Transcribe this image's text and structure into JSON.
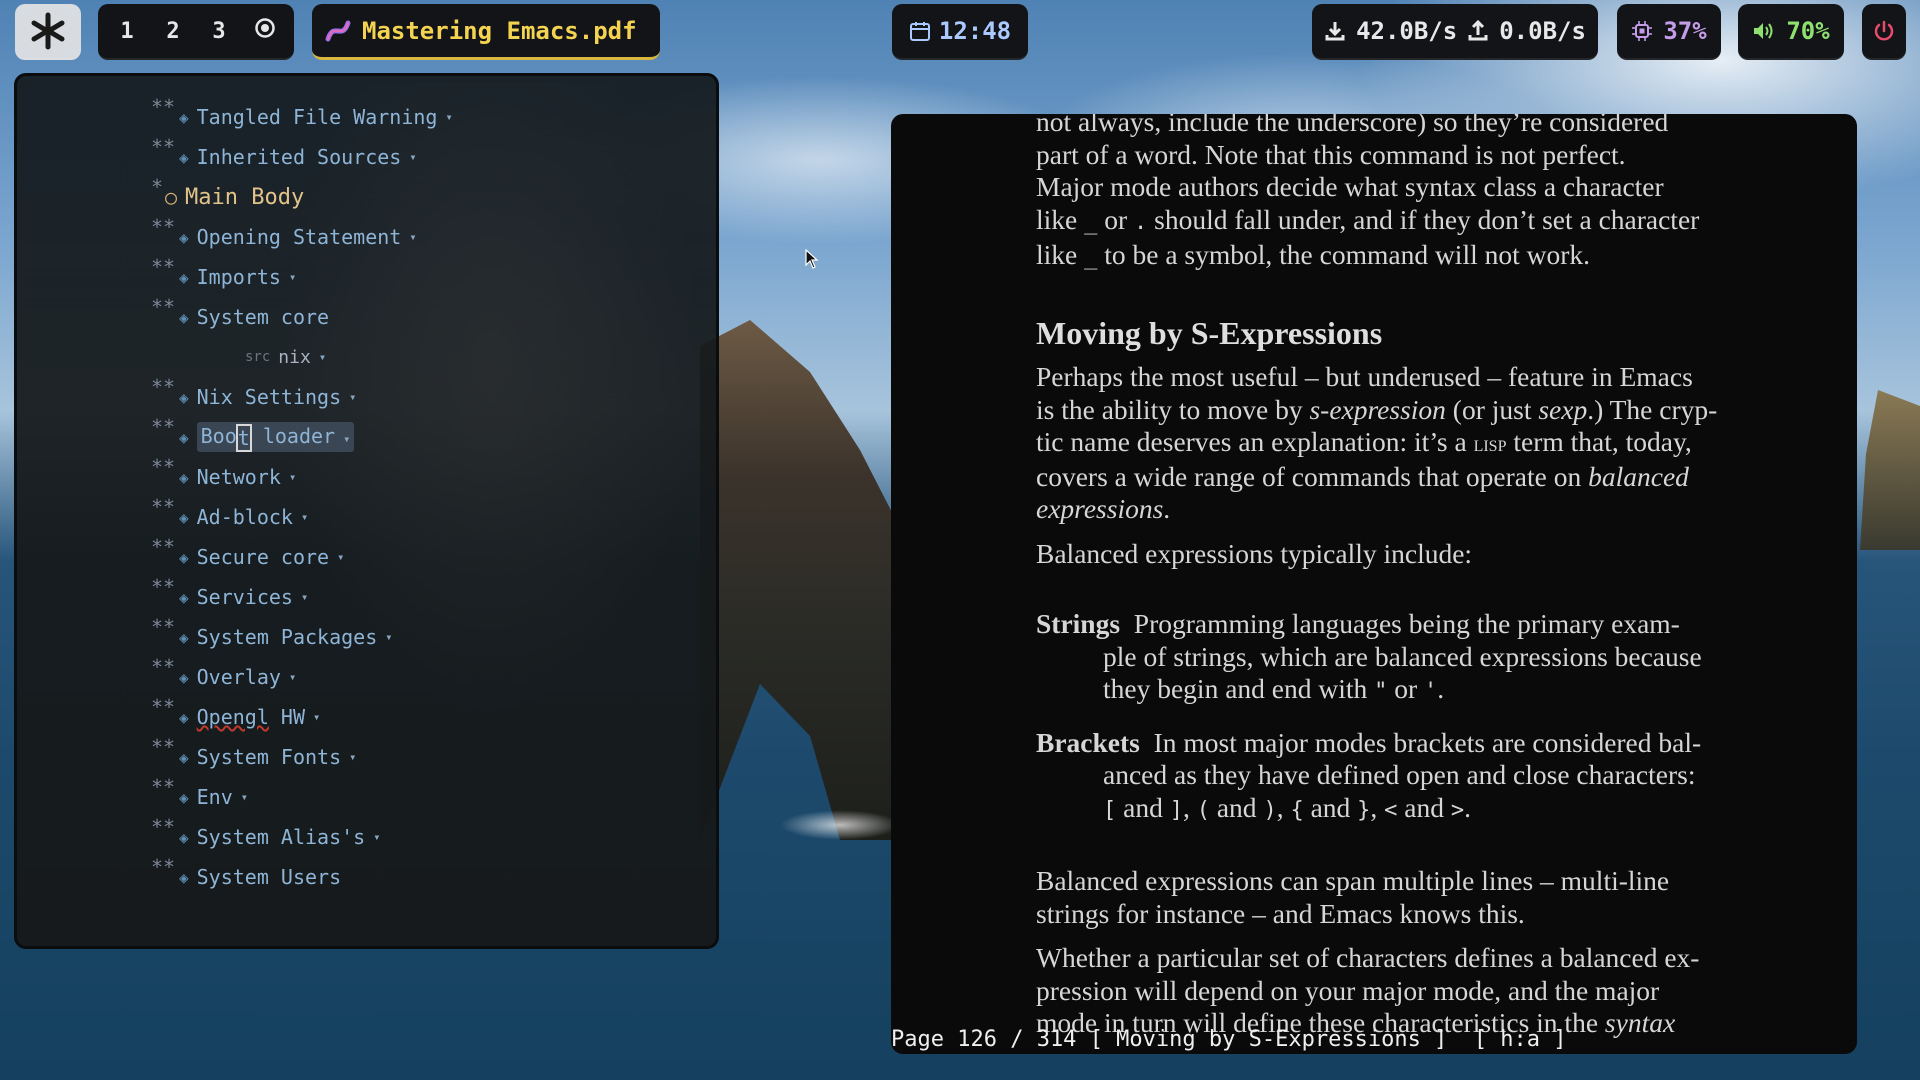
{
  "topbar": {
    "workspaces": [
      "1",
      "2",
      "3"
    ],
    "window_title": "Mastering Emacs.pdf",
    "clock": "12:48",
    "net_down": "42.0B/s",
    "net_up": "0.0B/s",
    "cpu": "37%",
    "volume": "70%"
  },
  "org": {
    "items": [
      {
        "stars": "**",
        "label": "Tangled File Warning",
        "fold": "▾"
      },
      {
        "stars": "**",
        "label": "Inherited Sources",
        "fold": "▾"
      },
      {
        "stars": "*",
        "label": "Main Body"
      },
      {
        "stars": "**",
        "label": "Opening Statement",
        "fold": "▾"
      },
      {
        "stars": "**",
        "label": "Imports",
        "fold": "▾"
      },
      {
        "stars": "**",
        "label": "System core"
      },
      {
        "src": "src",
        "lang": "nix",
        "fold": "▾"
      },
      {
        "stars": "**",
        "label": "Nix Settings",
        "fold": "▾"
      },
      {
        "stars": "**",
        "label_pre": "Boo",
        "label_cursor": "t",
        "label_post": " loader",
        "fold": "▾"
      },
      {
        "stars": "**",
        "label": "Network",
        "fold": "▾"
      },
      {
        "stars": "**",
        "label": "Ad-block",
        "fold": "▾"
      },
      {
        "stars": "**",
        "label": "Secure core",
        "fold": "▾"
      },
      {
        "stars": "**",
        "label": "Services",
        "fold": "▾"
      },
      {
        "stars": "**",
        "label": "System Packages",
        "fold": "▾"
      },
      {
        "stars": "**",
        "label": "Overlay",
        "fold": "▾"
      },
      {
        "stars": "**",
        "label_sq": "Opengl",
        "label_post": " HW",
        "fold": "▾"
      },
      {
        "stars": "**",
        "label": "System Fonts",
        "fold": "▾"
      },
      {
        "stars": "**",
        "label": "Env",
        "fold": "▾"
      },
      {
        "stars": "**",
        "label": "System Alias's",
        "fold": "▾"
      },
      {
        "stars": "**",
        "label": "System Users"
      }
    ]
  },
  "pdf": {
    "p1": [
      "not always, include the underscore) so they’re considered",
      "part of a word. Note that this command is not perfect.",
      "Major mode authors decide what syntax class a character",
      "like",
      "or",
      "should fall under, and if they don’t set a character",
      "like",
      "to be a symbol, the command will not work."
    ],
    "section": "Moving by S-Expressions",
    "p2": [
      "Perhaps the most useful – but underused – feature in Emacs",
      "is the ability to move by",
      "s-expression",
      "(or just",
      "sexp",
      ".) The cryp-",
      "tic name deserves an explanation: it’s a",
      "lisp",
      "term that, today,",
      "covers a wide range of commands that operate on",
      "balanced",
      "expressions",
      "."
    ],
    "p3": "Balanced expressions typically include:",
    "strings_term": "Strings",
    "strings_text": [
      "Programming languages being the primary exam-",
      "ple of strings, which are balanced expressions because",
      "they begin and end with",
      "or",
      "."
    ],
    "brackets_term": "Brackets",
    "brackets_text": [
      "In most major modes brackets are considered bal-",
      "anced as they have defined open and close characters:",
      "and",
      "and",
      "and",
      "and",
      "."
    ],
    "p4": [
      "Balanced expressions can span multiple lines – multi-line",
      "strings for instance – and Emacs knows this."
    ],
    "p5": [
      "Whether a particular set of characters defines a balanced ex-",
      "pression will depend on your major mode, and the major",
      "mode in turn will define these characteristics in the",
      "syntax"
    ],
    "glyphs": {
      "underscore": "_",
      "dot": ".",
      "dquote": "\"",
      "squote": "'",
      "lbr": "[",
      "rbr": "]",
      "lpar": "(",
      "rpar": ")",
      "lcb": "{",
      "rcb": "}",
      "lt": "<",
      "gt": ">"
    }
  },
  "status": {
    "page": "Page 126 / 314",
    "section": "[ Moving by S-Expressions ]",
    "mode": "[ h:a ]"
  },
  "colors": {
    "accent": "#f3d350",
    "clock": "#a9c9ff",
    "cpu": "#c49ce8",
    "volume": "#8fe06e",
    "power": "#e84a6a"
  }
}
